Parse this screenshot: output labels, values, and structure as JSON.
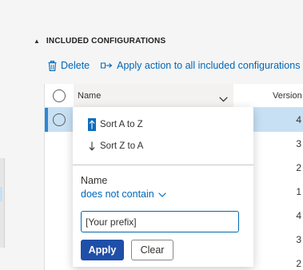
{
  "section": {
    "caret_glyph": "▲",
    "title": "INCLUDED CONFIGURATIONS"
  },
  "toolbar": {
    "delete_label": "Delete",
    "delete_icon": "trash-icon",
    "apply_label": "Apply action to all included configurations",
    "apply_icon": "apply-action-icon"
  },
  "grid": {
    "columns": {
      "name": "Name",
      "version": "Version"
    },
    "rows": [
      {
        "version": "4",
        "selected": true
      },
      {
        "version": "3",
        "selected": false
      },
      {
        "version": "2",
        "selected": false
      },
      {
        "version": "1",
        "selected": false
      },
      {
        "version": "4",
        "selected": false
      },
      {
        "version": "3",
        "selected": false
      },
      {
        "version": "2",
        "selected": false
      }
    ]
  },
  "column_menu": {
    "sort_asc": "Sort A to Z",
    "sort_desc": "Sort Z to A",
    "filter_field_label": "Name",
    "filter_operator": "does not contain",
    "filter_value": "[Your prefix]",
    "apply_label": "Apply",
    "clear_label": "Clear"
  },
  "colors": {
    "accent": "#0067b8",
    "apply_button": "#1f4fa8",
    "selected_row": "#c7e0f4"
  }
}
